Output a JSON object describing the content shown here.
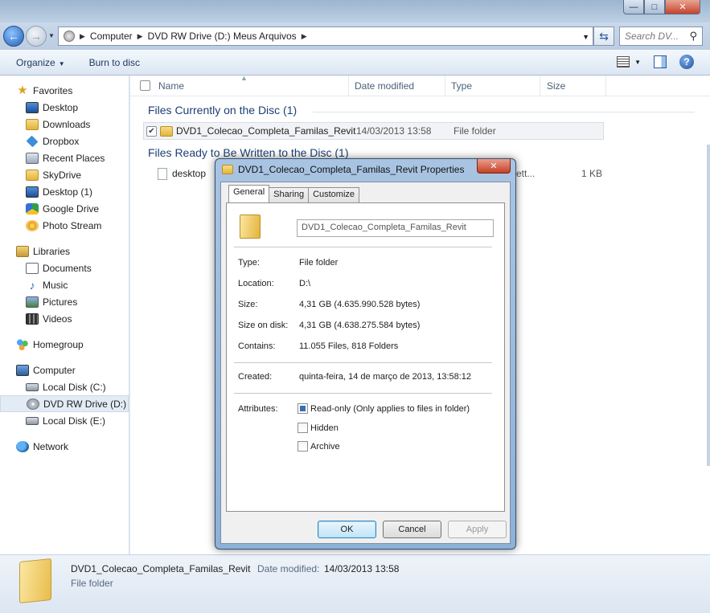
{
  "window": {
    "minimize": "—",
    "maximize": "□",
    "close": "✕"
  },
  "address": {
    "segments": [
      "Computer",
      "DVD RW Drive (D:) Meus Arquivos"
    ],
    "search_placeholder": "Search DV..."
  },
  "commands": {
    "organize": "Organize",
    "burn": "Burn to disc"
  },
  "sidebar": {
    "favorites": {
      "label": "Favorites",
      "items": [
        "Desktop",
        "Downloads",
        "Dropbox",
        "Recent Places",
        "SkyDrive",
        "Desktop (1)",
        "Google Drive",
        "Photo Stream"
      ]
    },
    "libraries": {
      "label": "Libraries",
      "items": [
        "Documents",
        "Music",
        "Pictures",
        "Videos"
      ]
    },
    "homegroup": "Homegroup",
    "computer": {
      "label": "Computer",
      "items": [
        "Local Disk (C:)",
        "DVD RW Drive (D:) M",
        "Local Disk (E:)"
      ]
    },
    "network": "Network"
  },
  "columns": {
    "name": "Name",
    "date_modified": "Date modified",
    "type": "Type",
    "size": "Size"
  },
  "groups": {
    "on_disc": "Files Currently on the Disc (1)",
    "ready": "Files Ready to Be Written to the Disc (1)"
  },
  "files": {
    "disc_item": {
      "name": "DVD1_Colecao_Completa_Familas_Revit",
      "date": "14/03/2013 13:58",
      "type": "File folder"
    },
    "ready_item": {
      "name": "desktop",
      "type_partial": "ett...",
      "size": "1 KB"
    }
  },
  "details": {
    "name": "DVD1_Colecao_Completa_Familas_Revit",
    "date_label": "Date modified:",
    "date": "14/03/2013 13:58",
    "type": "File folder"
  },
  "dialog": {
    "title": "DVD1_Colecao_Completa_Familas_Revit Properties",
    "close": "✕",
    "tabs": [
      "General",
      "Sharing",
      "Customize"
    ],
    "name_field": "DVD1_Colecao_Completa_Familas_Revit",
    "props": {
      "type_label": "Type:",
      "type_value": "File folder",
      "location_label": "Location:",
      "location_value": "D:\\",
      "size_label": "Size:",
      "size_value": "4,31 GB (4.635.990.528 bytes)",
      "size_on_disk_label": "Size on disk:",
      "size_on_disk_value": "4,31 GB (4.638.275.584 bytes)",
      "contains_label": "Contains:",
      "contains_value": "11.055 Files, 818 Folders",
      "created_label": "Created:",
      "created_value": "quinta-feira, 14 de março de 2013, 13:58:12",
      "attributes_label": "Attributes:"
    },
    "attributes": {
      "readonly": "Read-only (Only applies to files in folder)",
      "hidden": "Hidden",
      "archive": "Archive"
    },
    "buttons": {
      "ok": "OK",
      "cancel": "Cancel",
      "apply": "Apply"
    }
  }
}
